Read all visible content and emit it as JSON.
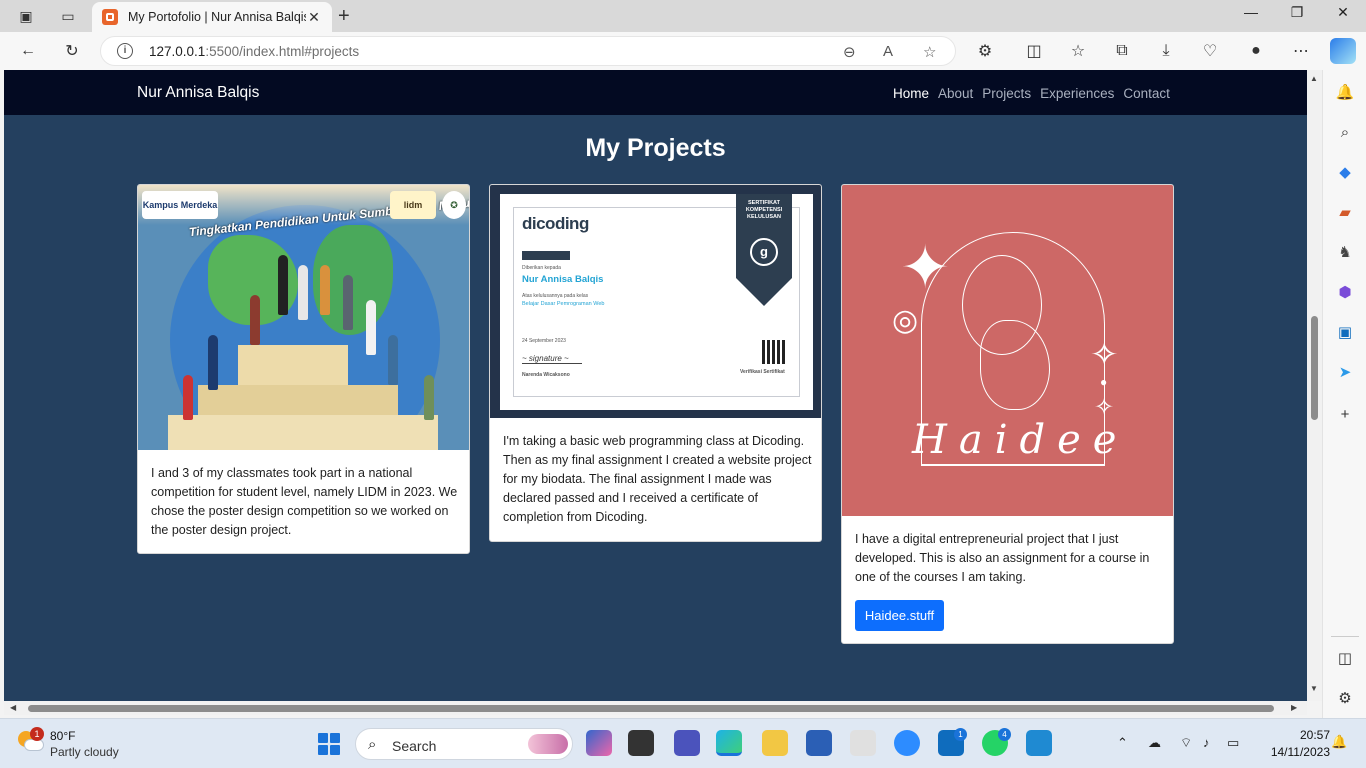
{
  "browser": {
    "tab_title": "My Portofolio | Nur Annisa Balqis",
    "url_host": "127.0.0.1",
    "url_rest": ":5500/index.html#projects"
  },
  "page": {
    "brand": "Nur Annisa Balqis",
    "nav": [
      "Home",
      "About",
      "Projects",
      "Experiences",
      "Contact"
    ],
    "active_nav": "Home",
    "section_title": "My Projects",
    "projects": [
      {
        "image": "lidm-poster",
        "poster_text": "Tingkatkan Pendidikan Untuk Sumber Daya Manusia Berdaya",
        "logo_left": "Kampus Merdeka",
        "logo_right": "lidm",
        "text": "I and 3 of my classmates took part in a national competition for student level, namely LIDM in 2023. We chose the poster design competition so we worked on the poster design project."
      },
      {
        "image": "dicoding-certificate",
        "cert": {
          "logo": "dicoding",
          "ribbon": "SERTIFIKAT KOMPETENSI KELULUSAN",
          "given_to": "Diberikan kepada",
          "name": "Nur Annisa Balqis",
          "passed": "Atas kelulusannya pada kelas",
          "course": "Belajar Dasar Pemrograman Web",
          "date": "24 September 2023",
          "signer": "Narenda Wicaksono",
          "verify": "Verifikasi Sertifikat"
        },
        "text": "I'm taking a basic web programming class at Dicoding. Then as my final assignment I created a website project for my biodata. The final assignment I made was declared passed and I received a certificate of completion from Dicoding."
      },
      {
        "image": "haidee-logo",
        "logo_word": "Haidee",
        "text": "I have a digital entrepreneurial project that I just developed. This is also an assignment for a course in one of the courses I am taking.",
        "button": "Haidee.stuff"
      }
    ]
  },
  "taskbar": {
    "weather_badge": "1",
    "temp": "80°F",
    "condition": "Partly cloudy",
    "search": "Search",
    "outlook_badge": "1",
    "whatsapp_badge": "4",
    "time": "20:57",
    "date": "14/11/2023"
  },
  "colors": {
    "page_bg": "#24405f",
    "navbar_bg": "#030a22",
    "button": "#0d6efd",
    "haidee_bg": "#cd6866"
  }
}
